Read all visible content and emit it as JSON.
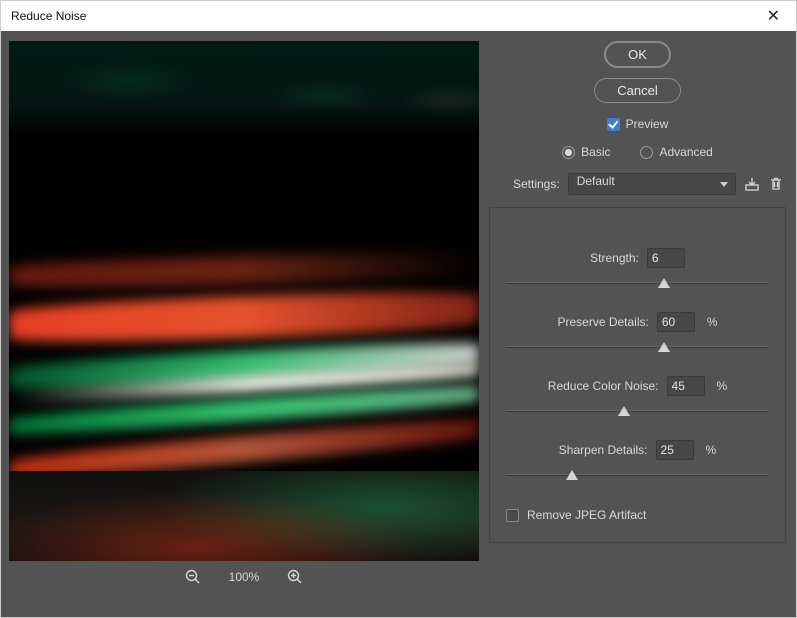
{
  "window": {
    "title": "Reduce Noise"
  },
  "buttons": {
    "ok": "OK",
    "cancel": "Cancel"
  },
  "preview": {
    "label": "Preview",
    "checked": true
  },
  "mode": {
    "basic": "Basic",
    "advanced": "Advanced",
    "selected": "basic"
  },
  "settings": {
    "label": "Settings:",
    "value": "Default"
  },
  "sliders": {
    "strength": {
      "label": "Strength:",
      "value": "6",
      "max": 10,
      "percent": 60,
      "show_pct": false
    },
    "preserve": {
      "label": "Preserve Details:",
      "value": "60",
      "max": 100,
      "percent": 60,
      "show_pct": true
    },
    "color_noise": {
      "label": "Reduce Color Noise:",
      "value": "45",
      "max": 100,
      "percent": 45,
      "show_pct": true
    },
    "sharpen": {
      "label": "Sharpen Details:",
      "value": "25",
      "max": 100,
      "percent": 25,
      "show_pct": true
    }
  },
  "remove_jpeg": {
    "label": "Remove JPEG Artifact",
    "checked": false
  },
  "zoom": {
    "level": "100%"
  }
}
